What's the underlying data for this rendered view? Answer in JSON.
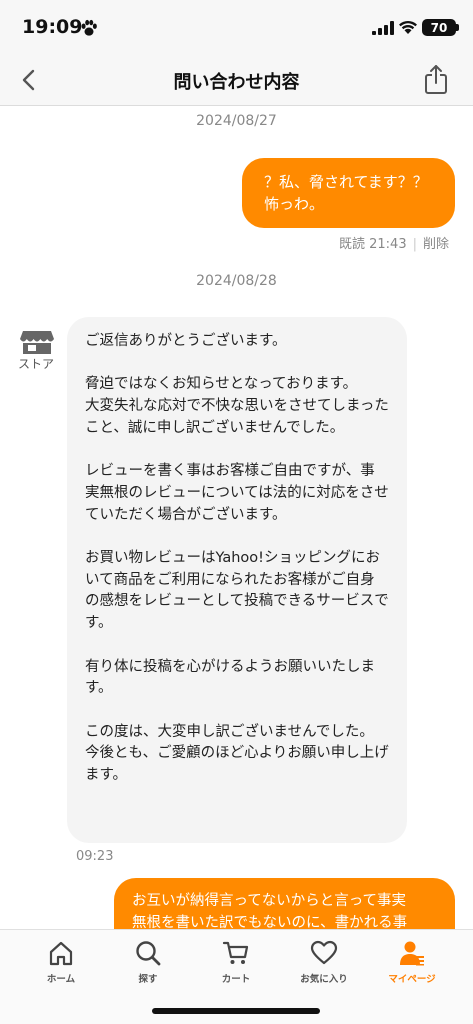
{
  "status_bar": {
    "time": "19:09",
    "battery": "70"
  },
  "nav": {
    "title": "問い合わせ内容"
  },
  "messages": {
    "date1": "2024/08/27",
    "out1": {
      "line1": "？私、脅されてます？？",
      "line2": "怖っわ。"
    },
    "out1_meta": {
      "read": "既読 21:43",
      "delete": "削除"
    },
    "date2": "2024/08/28",
    "store_label": "ストア",
    "in1": {
      "text": "ご返信ありがとうございます。\n\n脅迫ではなくお知らせとなっております。\n大変失礼な応対で不快な思いをさせてしまったこと、誠に申し訳ございませんでした。\n\nレビューを書く事はお客様ご自由ですが、事実無根のレビューについては法的に対応をさせていただく場合がございます。\n\nお買い物レビューはYahoo!ショッピングにおいて商品をご利用になられたお客様がご自身の感想をレビューとして投稿できるサービスです。\n\n有り体に投稿を心がけるようお願いいたします。\n\nこの度は、大変申し訳ございませんでした。\n今後とも、ご愛顧のほど心よりお願い申し上げます。"
    },
    "in1_time": "09:23",
    "out2": {
      "line1": "お互いが納得言ってないからと言って事実",
      "line2": "無根を書いた訳でもないのに、書かれる事"
    }
  },
  "tabs": [
    {
      "label": "ホーム",
      "icon": "home-icon"
    },
    {
      "label": "探す",
      "icon": "search-icon"
    },
    {
      "label": "カート",
      "icon": "cart-icon"
    },
    {
      "label": "お気に入り",
      "icon": "heart-icon"
    },
    {
      "label": "マイページ",
      "icon": "person-icon",
      "active": true
    }
  ],
  "colors": {
    "accent": "#ff8a00",
    "bubble_in": "#f4f4f4"
  }
}
